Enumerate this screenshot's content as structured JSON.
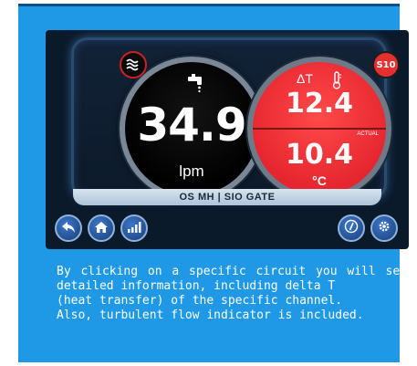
{
  "screen": {
    "flow": {
      "value": "34.9",
      "unit": "lpm",
      "icon": "water-tap-icon"
    },
    "temperature": {
      "delta_label": "ΔT",
      "delta_value": "12.4",
      "actual_label": "ACTUAL",
      "actual_value": "10.4",
      "unit": "°C",
      "icon": "thermometer-icon"
    },
    "turbulent_indicator": {
      "icon": "turbulent-flow-icon"
    },
    "channel_badge": "S10",
    "gate_label": "OS MH | SIO GATE",
    "nav": [
      {
        "icon": "back-arrow-icon"
      },
      {
        "icon": "home-icon"
      },
      {
        "icon": "chart-icon"
      },
      {
        "icon": "info-icon"
      },
      {
        "icon": "gear-icon"
      }
    ]
  },
  "caption": {
    "line1": "By clicking on a specific circuit you will see detailed information, including delta T",
    "line2": "(heat transfer) of the specific channel.",
    "line3": "Also, turbulent flow indicator is included."
  },
  "colors": {
    "card_background": "#1f98e6",
    "screen_background": "#0b1a2a",
    "temperature_gauge": "#e6262f",
    "flow_gauge": "#000000",
    "nav_button": "#2b5fa8"
  }
}
